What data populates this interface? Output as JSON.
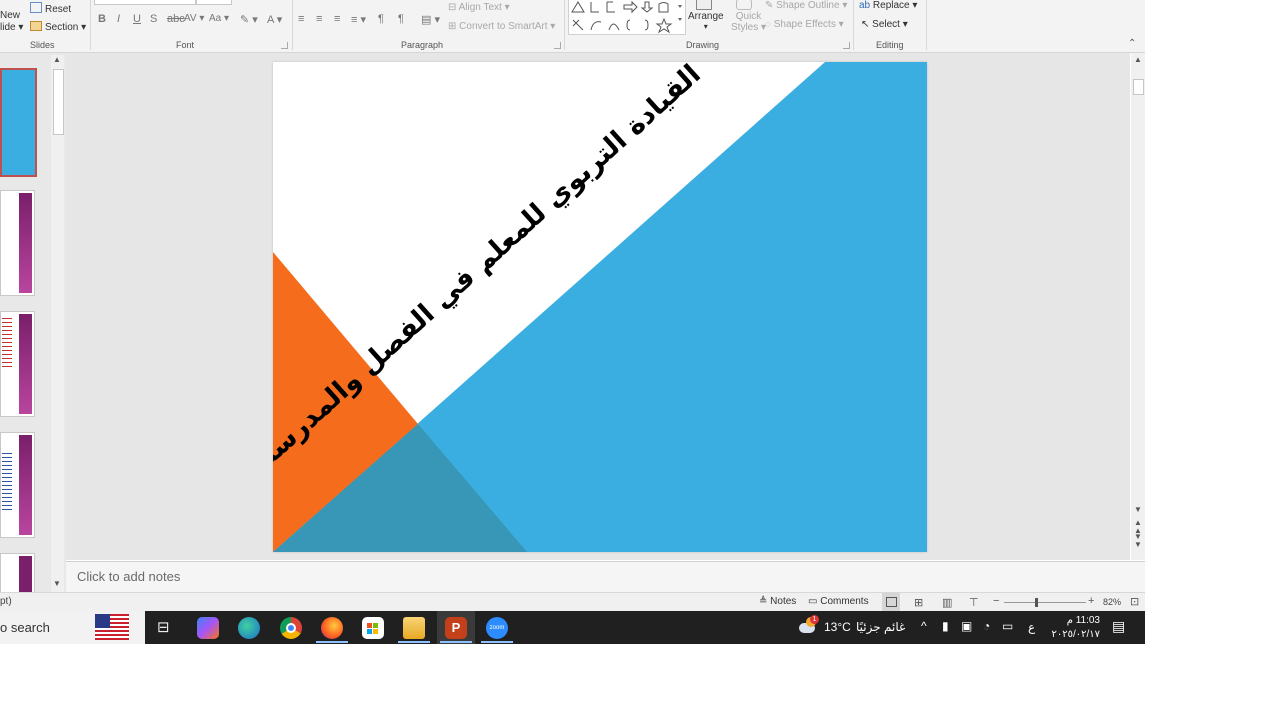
{
  "ribbon": {
    "slides_group": {
      "new_slide_line1": "New",
      "new_slide_line2": "lide",
      "reset": "Reset",
      "section": "Section",
      "label": "Slides"
    },
    "font_group": {
      "bold": "B",
      "italic": "I",
      "underline": "U",
      "strike": "S",
      "char_spacing": "AV",
      "change_case": "Aa",
      "font_color": "A",
      "label": "Font"
    },
    "paragraph_group": {
      "align_text": "Align Text",
      "convert_smartart": "Convert to SmartArt",
      "label": "Paragraph"
    },
    "drawing_group": {
      "arrange": "Arrange",
      "quick_styles_line1": "Quick",
      "quick_styles_line2": "Styles",
      "shape_outline": "Shape Outline",
      "shape_effects": "Shape Effects",
      "label": "Drawing"
    },
    "editing_group": {
      "replace": "Replace",
      "select": "Select",
      "label": "Editing"
    }
  },
  "slide": {
    "title": "القيادة التربوي للمعلم في الفصل والمدرسة",
    "colors": {
      "blue": "#3aaee0",
      "orange": "#f46c1c",
      "overlap": "#3896b6",
      "white": "#ffffff"
    }
  },
  "notes": {
    "placeholder": "Click to add notes"
  },
  "status": {
    "left_fragment": "pt)",
    "notes_label": "Notes",
    "comments_label": "Comments",
    "zoom": "82%"
  },
  "taskbar": {
    "search_fragment": "o search",
    "weather_temp": "13°C",
    "weather_text": "غائم جزئيًا",
    "lang": "ع",
    "time": "11:03 م",
    "date": "٢٠٢٥/٠٢/١٧",
    "notification_count": "1"
  },
  "icons": [
    "new-slide-icon",
    "reset-icon",
    "section-icon",
    "shape-gallery-icon",
    "arrange-icon",
    "quick-styles-icon",
    "shape-outline-icon",
    "shape-effects-icon",
    "replace-icon",
    "select-icon",
    "collapse-ribbon-icon",
    "notes-icon",
    "comments-icon",
    "normal-view-icon",
    "slide-sorter-icon",
    "reading-view-icon",
    "slideshow-icon",
    "fit-slide-icon",
    "us-flag-icon",
    "task-view-icon",
    "copilot-icon",
    "edge-icon",
    "chrome-icon",
    "firefox-icon",
    "store-icon",
    "file-explorer-icon",
    "powerpoint-icon",
    "zoom-icon",
    "weather-icon",
    "mic-icon",
    "display-icon",
    "wifi-icon",
    "battery-icon",
    "notification-icon"
  ]
}
